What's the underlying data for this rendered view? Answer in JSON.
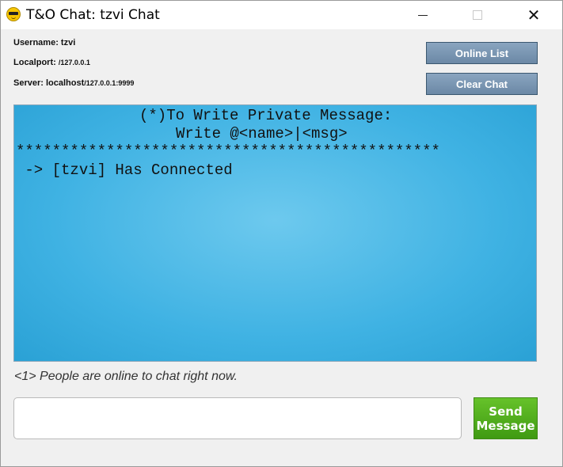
{
  "window": {
    "title": "T&O Chat: tzvi Chat",
    "app_icon": "smiley-sunglasses-icon",
    "minimize_icon": "minimize-icon",
    "maximize_icon": "maximize-icon",
    "close_symbol": "✕"
  },
  "info": {
    "username_label": "Username:",
    "username_value": "tzvi",
    "localport_label": "Localport:",
    "localport_value": "/127.0.0.1",
    "server_label": "Server:",
    "server_host": "localhost",
    "server_value": "/127.0.0.1:9999"
  },
  "buttons": {
    "online_list": "Online List",
    "clear_chat": "Clear Chat",
    "send_line1": "Send",
    "send_line2": "Message"
  },
  "chat": {
    "lines": [
      "(*)To Write Private Message:",
      "Write @<name>|<msg>",
      "***********************************************",
      " -> [tzvi] Has Connected"
    ]
  },
  "status": {
    "online_text": "<1> People are online to chat right now."
  },
  "input": {
    "value": ""
  },
  "colors": {
    "chat_bg": "#3fb2e3",
    "button_blue": "#7a96b4",
    "send_green": "#4fae1c"
  }
}
